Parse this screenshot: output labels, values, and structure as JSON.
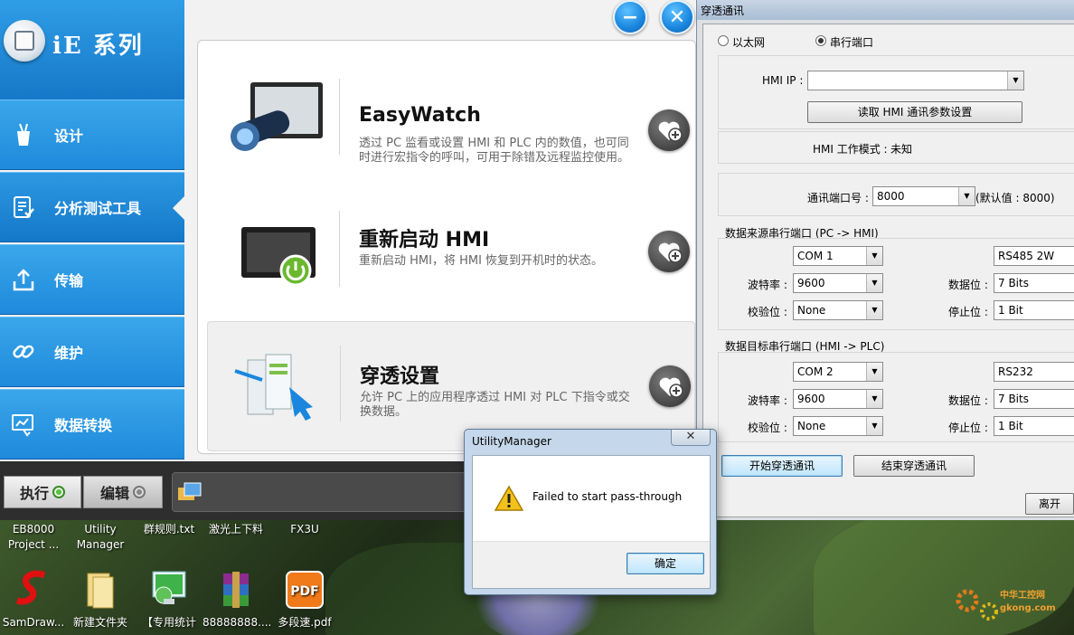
{
  "app": {
    "logo_text": "iE 系列",
    "sidebar": [
      {
        "id": "design",
        "label": "设计",
        "icon": "pencil-cup-icon"
      },
      {
        "id": "analysis",
        "label": "分析测试工具",
        "icon": "clipboard-check-icon"
      },
      {
        "id": "transfer",
        "label": "传输",
        "icon": "upload-icon"
      },
      {
        "id": "maintain",
        "label": "维护",
        "icon": "link-icon"
      },
      {
        "id": "convert",
        "label": "数据转换",
        "icon": "data-convert-icon"
      }
    ],
    "active_sidebar": "analysis",
    "features": [
      {
        "title": "EasyWatch",
        "desc": "透过 PC 监看或设置 HMI 和 PLC 内的数值，也可同时进行宏指令的呼叫，可用于除错及远程监控使用。",
        "icon": "camera-monitor-icon"
      },
      {
        "title": "重新启动 HMI",
        "desc": "重新启动 HMI，将 HMI 恢复到开机时的状态。",
        "icon": "hmi-power-icon"
      },
      {
        "title": "穿透设置",
        "desc": "允许 PC 上的应用程序透过 HMI 对 PLC 下指令或交换数据。",
        "icon": "pass-through-icon"
      }
    ],
    "tabs": {
      "run": "执行",
      "edit": "编辑"
    },
    "colors": {
      "sidebar_blue": "#1f8adb",
      "accent": "#1a86de"
    }
  },
  "passthrough": {
    "window_title": "穿透通讯",
    "mode_ethernet": "以太网",
    "mode_serial": "串行端口",
    "selected_mode": "serial",
    "hmi_ip_label": "HMI IP :",
    "hmi_ip_value": "",
    "read_button": "读取 HMI 通讯参数设置",
    "work_mode_label": "HMI 工作模式 :",
    "work_mode_value": "未知",
    "port_label": "通讯端口号 :",
    "port_value": "8000",
    "port_default": "(默认值 : 8000)",
    "source": {
      "title": "数据来源串行端口 (PC -> HMI)",
      "com": "COM 1",
      "type": "RS485 2W",
      "baud_label": "波特率 :",
      "baud": "9600",
      "databits_label": "数据位 :",
      "databits": "7 Bits",
      "parity_label": "校验位 :",
      "parity": "None",
      "stopbits_label": "停止位 :",
      "stopbits": "1 Bit"
    },
    "target": {
      "title": "数据目标串行端口 (HMI -> PLC)",
      "com": "COM 2",
      "type": "RS232",
      "baud_label": "波特率 :",
      "baud": "9600",
      "databits_label": "数据位 :",
      "databits": "7 Bits",
      "parity_label": "校验位 :",
      "parity": "None",
      "stopbits_label": "停止位 :",
      "stopbits": "1 Bit"
    },
    "start_button": "开始穿透通讯",
    "stop_button": "结束穿透通讯",
    "exit_button": "离开"
  },
  "dialog": {
    "title": "UtilityManager",
    "message": "Failed to start pass-through",
    "ok_button": "确定",
    "icon": "warning-icon"
  },
  "desktop": {
    "top_row": [
      "EB8000 Project ...",
      "Utility Manager",
      "群规则.txt",
      "激光上下料",
      "FX3U"
    ],
    "icons": [
      {
        "label": "SamDraw...",
        "icon": "samdraw-icon"
      },
      {
        "label": "新建文件夹",
        "icon": "folder-icon"
      },
      {
        "label": "【专用统计",
        "icon": "monitor-globe-icon"
      },
      {
        "label": "88888888....",
        "icon": "winrar-archive-icon"
      },
      {
        "label": "多段速.pdf",
        "icon": "pdf-icon"
      }
    ],
    "watermark": "中华工控网 gkong.com"
  }
}
